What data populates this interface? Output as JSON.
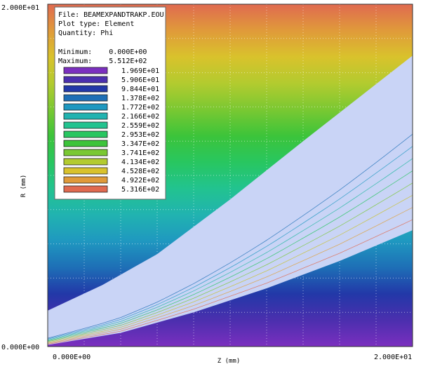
{
  "chart_data": {
    "type": "heatmap",
    "title": "",
    "xlabel": "Z (mm)",
    "ylabel": "R (mm)",
    "xlim": [
      0.0,
      20.0
    ],
    "ylim": [
      0.0,
      20.0
    ],
    "x_tick_labels": [
      "0.000E+00",
      "2.000E+01"
    ],
    "y_tick_labels": [
      "0.000E+00",
      "2.000E+01"
    ],
    "grid": true,
    "legend_placement": "top-left",
    "info": {
      "file": "File: BEAMEXPANDTRAKP.EOU",
      "plot_type": "Plot type: Element",
      "quantity": "Quantity: Phi",
      "minimum": "Minimum:    0.000E+00",
      "maximum": "Maximum:    5.512E+02"
    },
    "color_scale": [
      {
        "label": "1.969E+01",
        "value": 19.69,
        "color": "#7b2fbf"
      },
      {
        "label": "5.906E+01",
        "value": 59.06,
        "color": "#4b2fae"
      },
      {
        "label": "9.844E+01",
        "value": 98.44,
        "color": "#2238a8"
      },
      {
        "label": "1.378E+02",
        "value": 137.8,
        "color": "#1e6fb6"
      },
      {
        "label": "1.772E+02",
        "value": 177.2,
        "color": "#1f98c0"
      },
      {
        "label": "2.166E+02",
        "value": 216.6,
        "color": "#21b3b0"
      },
      {
        "label": "2.559E+02",
        "value": 255.9,
        "color": "#22c38f"
      },
      {
        "label": "2.953E+02",
        "value": 295.3,
        "color": "#28c660"
      },
      {
        "label": "3.347E+02",
        "value": 334.7,
        "color": "#3cc43a"
      },
      {
        "label": "3.741E+02",
        "value": 374.1,
        "color": "#7ac832"
      },
      {
        "label": "4.134E+02",
        "value": 413.4,
        "color": "#b3cb2f"
      },
      {
        "label": "4.528E+02",
        "value": 452.8,
        "color": "#d9c22c"
      },
      {
        "label": "4.922E+02",
        "value": 492.2,
        "color": "#e09a3a"
      },
      {
        "label": "5.316E+02",
        "value": 531.6,
        "color": "#e06a50"
      }
    ],
    "beam_color": "#c9d4f6",
    "beam_outer_edge": [
      [
        0.0,
        2.1
      ],
      [
        3.0,
        3.6
      ],
      [
        6.0,
        5.4
      ],
      [
        10.0,
        8.6
      ],
      [
        14.0,
        12.0
      ],
      [
        17.0,
        14.5
      ],
      [
        20.0,
        17.0
      ]
    ],
    "beam_inner_edge": [
      [
        0.0,
        0.1
      ],
      [
        4.0,
        0.8
      ],
      [
        8.0,
        2.0
      ],
      [
        12.0,
        3.4
      ],
      [
        16.0,
        5.0
      ],
      [
        20.0,
        6.8
      ]
    ]
  }
}
